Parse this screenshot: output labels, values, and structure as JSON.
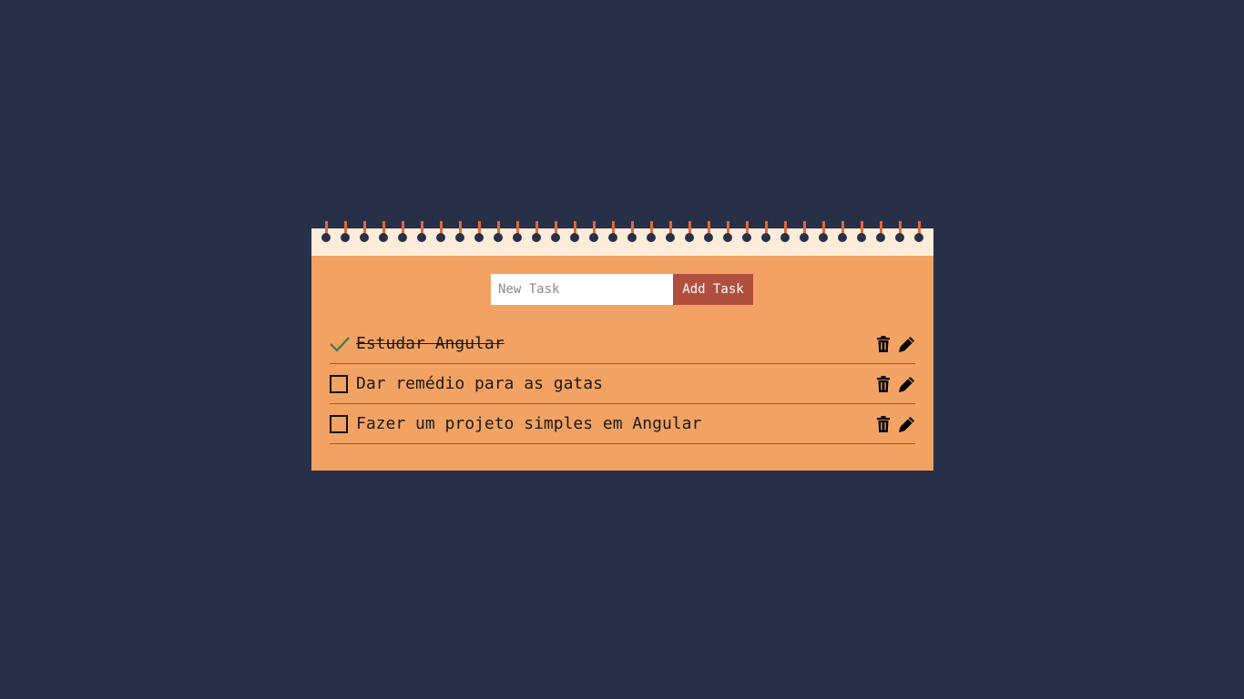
{
  "form": {
    "input_placeholder": "New Task",
    "input_value": "",
    "add_label": "Add Task"
  },
  "tasks": [
    {
      "text": "Estudar Angular",
      "done": true
    },
    {
      "text": "Dar remédio para as gatas",
      "done": false
    },
    {
      "text": "Fazer um projeto simples em Angular",
      "done": false
    }
  ],
  "icons": {
    "completed": "check-icon",
    "pending": "checkbox-icon",
    "delete": "trash-icon",
    "edit": "pencil-icon"
  },
  "colors": {
    "background": "#273048",
    "paper": "#f2a262",
    "binding": "#fdecd9",
    "spiral": "#e06b3d",
    "accent": "#b14f3f",
    "check": "#3f7a48"
  }
}
